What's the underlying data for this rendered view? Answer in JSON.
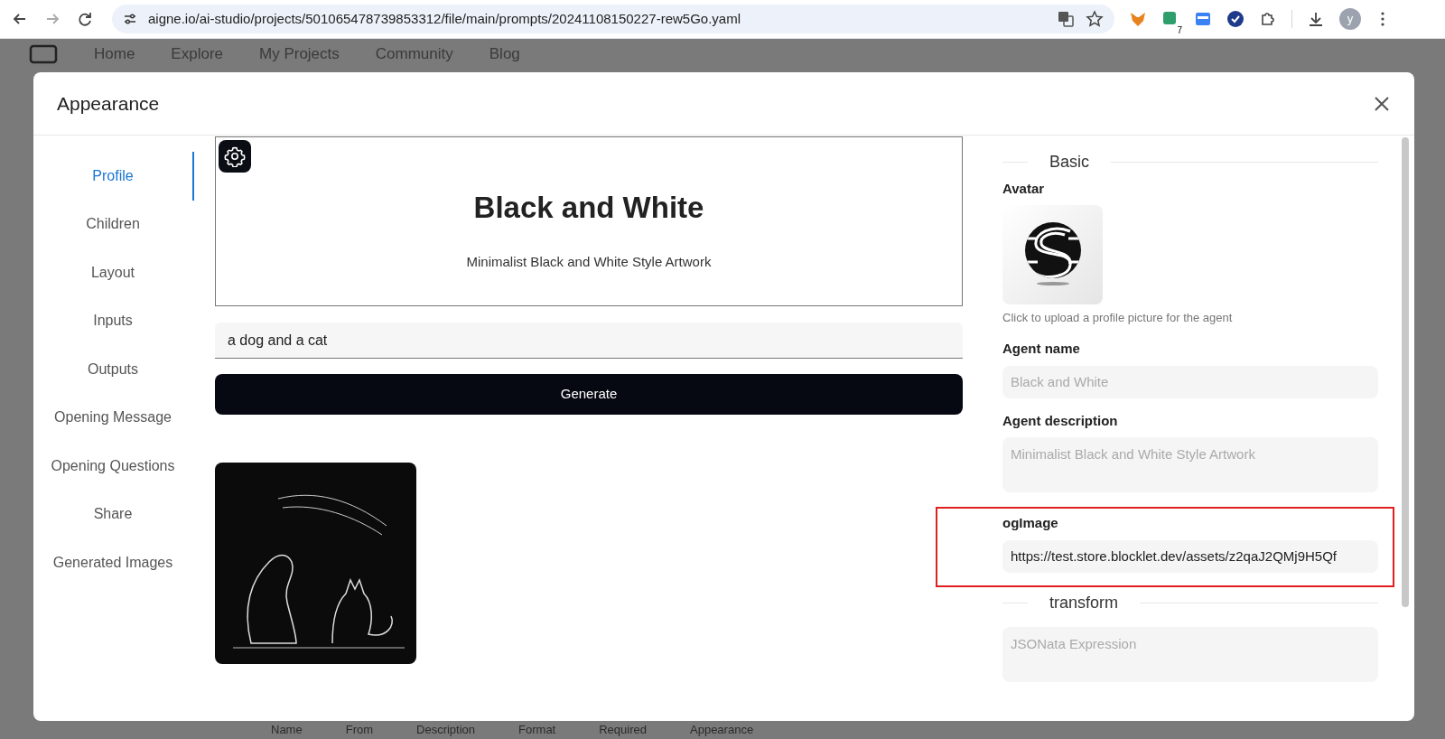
{
  "browser": {
    "url": "aigne.io/ai-studio/projects/501065478739853312/file/main/prompts/20241108150227-rew5Go.yaml",
    "extension_badge": "7",
    "profile_initial": "y"
  },
  "background_page": {
    "nav": [
      "Home",
      "Explore",
      "My Projects",
      "Community",
      "Blog"
    ],
    "table_columns": [
      "Name",
      "From",
      "Description",
      "Format",
      "Required",
      "Appearance"
    ]
  },
  "modal": {
    "title": "Appearance",
    "nav_items": [
      {
        "label": "Profile",
        "selected": true
      },
      {
        "label": "Children",
        "selected": false
      },
      {
        "label": "Layout",
        "selected": false
      },
      {
        "label": "Inputs",
        "selected": false
      },
      {
        "label": "Outputs",
        "selected": false
      },
      {
        "label": "Opening Message",
        "selected": false
      },
      {
        "label": "Opening Questions",
        "selected": false
      },
      {
        "label": "Share",
        "selected": false
      },
      {
        "label": "Generated Images",
        "selected": false
      }
    ],
    "preview": {
      "title": "Black and White",
      "description": "Minimalist Black and White Style Artwork",
      "prompt_value": "a dog and a cat",
      "generate_button": "Generate"
    },
    "form": {
      "sections": [
        {
          "title": "Basic",
          "fields": [
            {
              "kind": "avatar",
              "label": "Avatar",
              "hint": "Click to upload a profile picture for the agent",
              "highlighted": false
            },
            {
              "kind": "input",
              "label": "Agent name",
              "placeholder": "Black and White",
              "highlighted": false
            },
            {
              "kind": "textarea",
              "label": "Agent description",
              "placeholder": "Minimalist Black and White Style Artwork",
              "highlighted": false
            },
            {
              "kind": "input",
              "label": "ogImage",
              "value": "https://test.store.blocklet.dev/assets/z2qaJ2QMj9H5Qf",
              "highlighted": true
            }
          ]
        },
        {
          "title": "transform",
          "fields": [
            {
              "kind": "textarea",
              "placeholder": "JSONata Expression",
              "highlighted": false
            }
          ]
        }
      ]
    }
  }
}
